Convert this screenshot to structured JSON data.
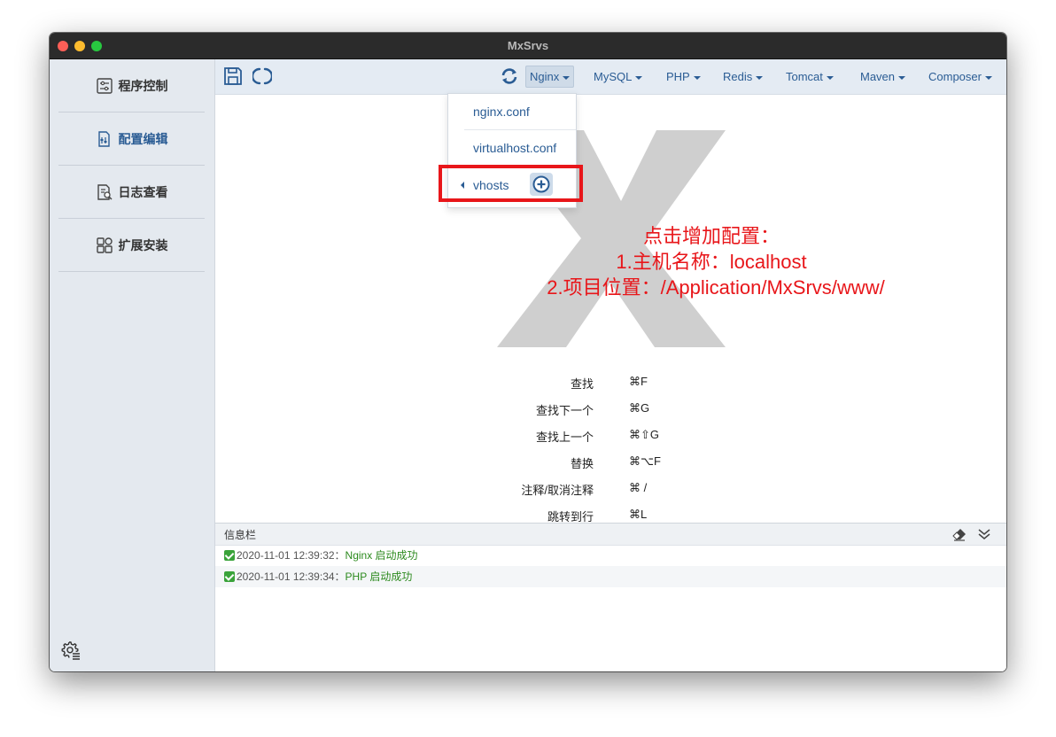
{
  "window": {
    "title": "MxSrvs"
  },
  "sidebar": {
    "items": [
      {
        "label": "程序控制",
        "icon": "sliders-icon"
      },
      {
        "label": "配置编辑",
        "icon": "config-edit-icon",
        "active": true
      },
      {
        "label": "日志查看",
        "icon": "log-view-icon"
      },
      {
        "label": "扩展安装",
        "icon": "extensions-icon"
      }
    ],
    "settings_icon": "settings-gear-icon"
  },
  "toolbar": {
    "save_icon": "save-icon",
    "reload_icon": "reload-icon",
    "refresh_icon": "sync-icon",
    "menus": [
      {
        "label": "Nginx",
        "open": true
      },
      {
        "label": "MySQL"
      },
      {
        "label": "PHP"
      },
      {
        "label": "Redis"
      },
      {
        "label": "Tomcat"
      },
      {
        "label": "Maven"
      },
      {
        "label": "Composer"
      }
    ]
  },
  "dropdown": {
    "items": [
      "nginx.conf",
      "virtualhost.conf"
    ],
    "submenu_label": "vhosts",
    "add_icon": "plus-circle-icon"
  },
  "annotation": {
    "line1": "点击增加配置：",
    "line2": "1.主机名称：localhost",
    "line3": "2.项目位置：/Application/MxSrvs/www/",
    "color": "#e8161a"
  },
  "shortcuts": [
    {
      "label": "查找",
      "key": "⌘F"
    },
    {
      "label": "查找下一个",
      "key": "⌘G"
    },
    {
      "label": "查找上一个",
      "key": "⌘⇧G"
    },
    {
      "label": "替换",
      "key": "⌘⌥F"
    },
    {
      "label": "注释/取消注释",
      "key": "⌘ /"
    },
    {
      "label": "跳转到行",
      "key": "⌘L"
    }
  ],
  "infobar": {
    "label": "信息栏",
    "logs": [
      {
        "time": "2020-11-01 12:39:32：",
        "message": "Nginx 启动成功"
      },
      {
        "time": "2020-11-01 12:39:34：",
        "message": "PHP 启动成功"
      }
    ]
  },
  "colors": {
    "accent": "#2a5c94",
    "success": "#2c8a1e",
    "annotation": "#e8161a"
  }
}
